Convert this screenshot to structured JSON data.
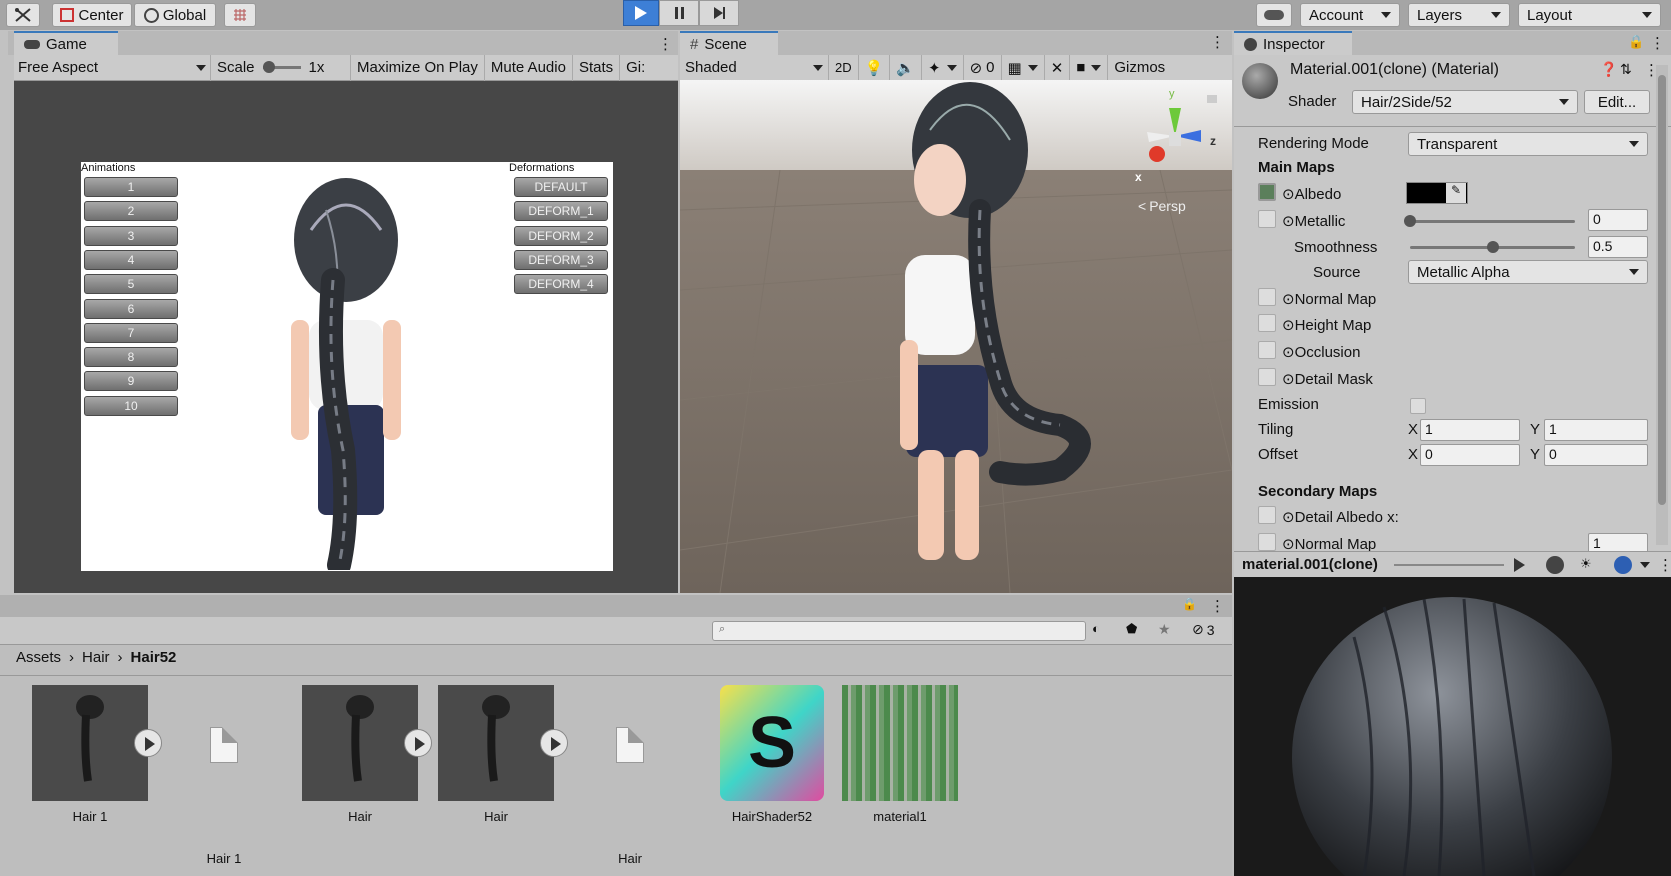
{
  "toolbar": {
    "center_label": "Center",
    "global_label": "Global",
    "account_label": "Account",
    "layers_label": "Layers",
    "layout_label": "Layout"
  },
  "game": {
    "tab_label": "Game",
    "aspect": "Free Aspect",
    "scale_label": "Scale",
    "scale_value": "1x",
    "maximize": "Maximize On Play",
    "mute": "Mute Audio",
    "stats": "Stats",
    "gizmos": "Gi:",
    "animations_header": "Animations",
    "deformations_header": "Deformations",
    "anim_buttons": [
      "1",
      "2",
      "3",
      "4",
      "5",
      "6",
      "7",
      "8",
      "9",
      "10"
    ],
    "deform_buttons": [
      "DEFAULT",
      "DEFORM_1",
      "DEFORM_2",
      "DEFORM_3",
      "DEFORM_4"
    ]
  },
  "scene": {
    "tab_label": "Scene",
    "shading": "Shaded",
    "mode_2d": "2D",
    "hidden_count": "0",
    "gizmos": "Gizmos",
    "persp": "Persp",
    "axis_x": "x",
    "axis_y": "y",
    "axis_z": "z"
  },
  "inspector": {
    "tab_label": "Inspector",
    "title": "Material.001(clone) (Material)",
    "shader_label": "Shader",
    "shader_value": "Hair/2Side/52",
    "edit_label": "Edit...",
    "rendering_mode_label": "Rendering Mode",
    "rendering_mode_value": "Transparent",
    "main_maps": "Main Maps",
    "albedo": "Albedo",
    "metallic": "Metallic",
    "metallic_value": "0",
    "metallic_level": 0,
    "smoothness": "Smoothness",
    "smoothness_value": "0.5",
    "smoothness_level": 0.5,
    "source": "Source",
    "source_value": "Metallic Alpha",
    "normal_map": "Normal Map",
    "height_map": "Height Map",
    "occlusion": "Occlusion",
    "detail_mask": "Detail Mask",
    "emission": "Emission",
    "tiling": "Tiling",
    "offset": "Offset",
    "x": "X",
    "y": "Y",
    "tiling_x": "1",
    "tiling_y": "1",
    "offset_x": "0",
    "offset_y": "0",
    "secondary_maps": "Secondary Maps",
    "detail_albedo": "Detail Albedo x:",
    "normal_map2": "Normal Map",
    "normal_map2_value": "1",
    "preview_title": "material.001(clone)"
  },
  "project": {
    "hidden_count": "3",
    "breadcrumb": [
      "Assets",
      "Hair",
      "Hair52"
    ],
    "assets": [
      {
        "name": "Hair 1",
        "kind": "model"
      },
      {
        "name": "Hair 1",
        "kind": "file"
      },
      {
        "name": "Hair",
        "kind": "model"
      },
      {
        "name": "Hair",
        "kind": "model"
      },
      {
        "name": "Hair",
        "kind": "file"
      },
      {
        "name": "HairShader52",
        "kind": "shader"
      },
      {
        "name": "material1",
        "kind": "texture"
      }
    ]
  },
  "colors": {
    "accent": "#3a79bb",
    "play_active": "#3d7fd6"
  }
}
